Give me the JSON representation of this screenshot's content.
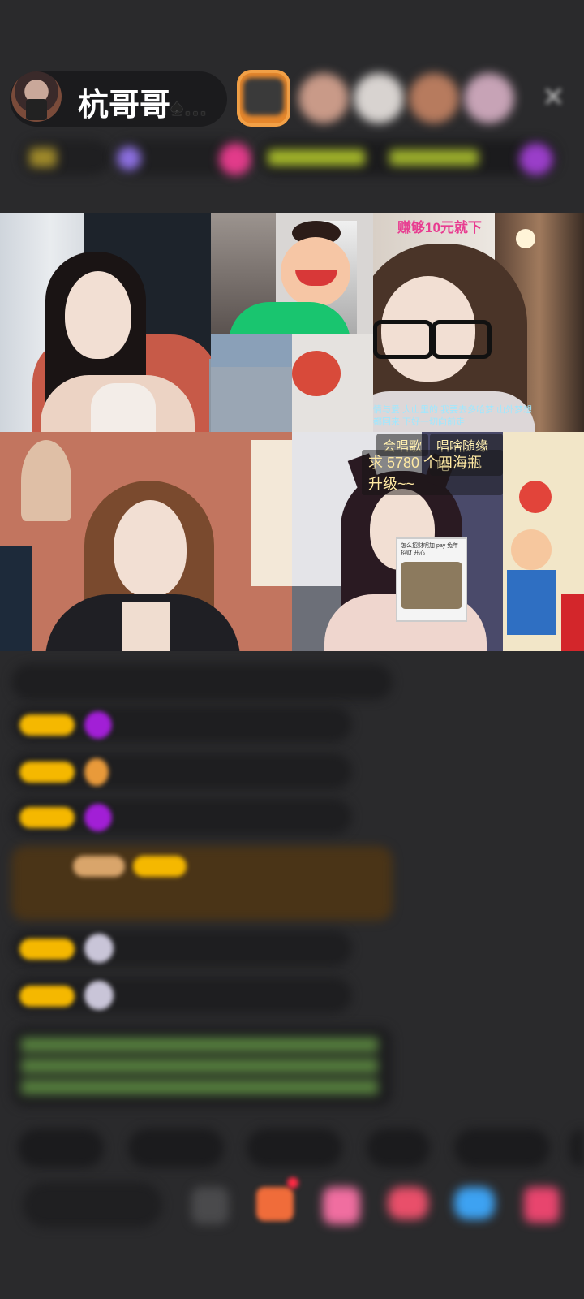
{
  "header": {
    "host_name": "杭哥哥",
    "host_suffix": "♠…",
    "close_icon": "close-icon"
  },
  "video_tiles": {
    "top_right_caption": "赚够10元就下",
    "top_right_subtitle": "情与爱  大山里的  我要去多哈梦  山外梦想都回来  下好一切向前走",
    "bottom_right_tag1": "会唱歌",
    "bottom_right_tag2": "唱啥随缘吧",
    "bottom_right_banner": "求 5780 个四海瓶升级~~",
    "phone_overlay_text": "怎么招财呢加  pay 兔年招财  开心"
  },
  "colors": {
    "background": "#2a2a2c",
    "caption_pink": "#e83d91",
    "gold_badge": "#f5b800"
  }
}
